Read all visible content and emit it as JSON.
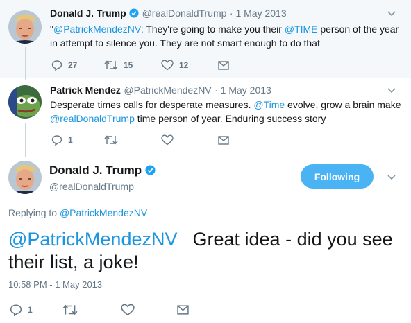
{
  "tweet1": {
    "name": "Donald J. Trump",
    "handle": "@realDonaldTrump",
    "date": "1 May 2013",
    "text_open_quote": "\"",
    "mention1": "@PatrickMendezNV",
    "text_part1": ": They're going to make you their ",
    "mention2": "@TIME",
    "text_part2": " person of the year",
    "text_line2": "in attempt to silence you.  They are not smart enough to do that",
    "replies": "27",
    "retweets": "15",
    "likes": "12"
  },
  "tweet2": {
    "name": "Patrick Mendez",
    "handle": "@PatrickMendezNV",
    "date": "1 May 2013",
    "text_part1": "Desperate times calls for desperate measures. ",
    "mention1": "@Time",
    "text_part2": " evolve, grow a brain make",
    "mention2": "@realDonaldTrump",
    "text_part3": " time person of year. Enduring success story",
    "replies": "1"
  },
  "main_tweet": {
    "name": "Donald J. Trump",
    "handle": "@realDonaldTrump",
    "follow_label": "Following",
    "replying_prefix": "Replying to ",
    "replying_to": "@PatrickMendezNV",
    "mention": "@PatrickMendezNV",
    "text_part1": "Great idea - did you see",
    "text_line2": "their list, a joke!",
    "timestamp": "10:58 PM - 1 May 2013",
    "replies": "1"
  },
  "icons": {
    "reply": "reply-icon",
    "retweet": "retweet-icon",
    "like": "heart-icon",
    "message": "envelope-icon",
    "more": "chevron-down-icon",
    "verified": "verified-badge-icon"
  },
  "colors": {
    "link": "#1b95e0",
    "follow_button": "#4ab3f4",
    "verified": "#1da1f2",
    "muted": "#657786",
    "reply_background": "#f5f8fa"
  }
}
